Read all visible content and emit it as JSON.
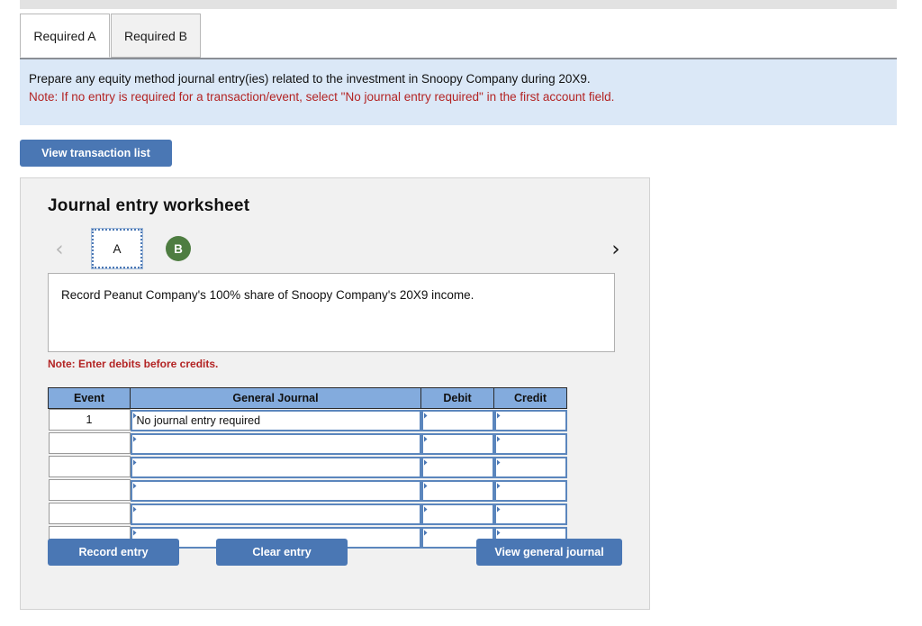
{
  "tabs": [
    {
      "label": "Required A",
      "active": true
    },
    {
      "label": "Required B",
      "active": false
    }
  ],
  "instructions": {
    "line1": "Prepare any equity method journal entry(ies) related to the investment in Snoopy Company during 20X9.",
    "line2": "Note: If no entry is required for a transaction/event, select \"No journal entry required\" in the first account field."
  },
  "toolbar": {
    "view_transaction_list_label": "View transaction list"
  },
  "worksheet": {
    "title": "Journal entry worksheet",
    "pager": {
      "prev_icon": "‹",
      "next_icon": "›",
      "pages": [
        {
          "label": "A",
          "state": "selected"
        },
        {
          "label": "B",
          "state": "completed"
        }
      ]
    },
    "transaction_description": "Record Peanut Company's 100% share of Snoopy Company's 20X9 income.",
    "note": "Note: Enter debits before credits.",
    "table": {
      "headers": [
        "Event",
        "General Journal",
        "Debit",
        "Credit"
      ],
      "rows": [
        {
          "event": "1",
          "journal": "No journal entry required",
          "debit": "",
          "credit": ""
        },
        {
          "event": "",
          "journal": "",
          "debit": "",
          "credit": ""
        },
        {
          "event": "",
          "journal": "",
          "debit": "",
          "credit": ""
        },
        {
          "event": "",
          "journal": "",
          "debit": "",
          "credit": ""
        },
        {
          "event": "",
          "journal": "",
          "debit": "",
          "credit": ""
        },
        {
          "event": "",
          "journal": "",
          "debit": "",
          "credit": ""
        }
      ]
    },
    "buttons": {
      "record_entry": "Record entry",
      "clear_entry": "Clear entry",
      "view_general_journal": "View general journal"
    }
  },
  "colors": {
    "button_blue": "#4a77b4",
    "table_header_blue": "#83abdd",
    "instruction_panel_blue": "#dbe8f7",
    "note_red": "#b32424",
    "page_b_green": "#4e7d41",
    "panel_gray": "#f1f1f1"
  }
}
